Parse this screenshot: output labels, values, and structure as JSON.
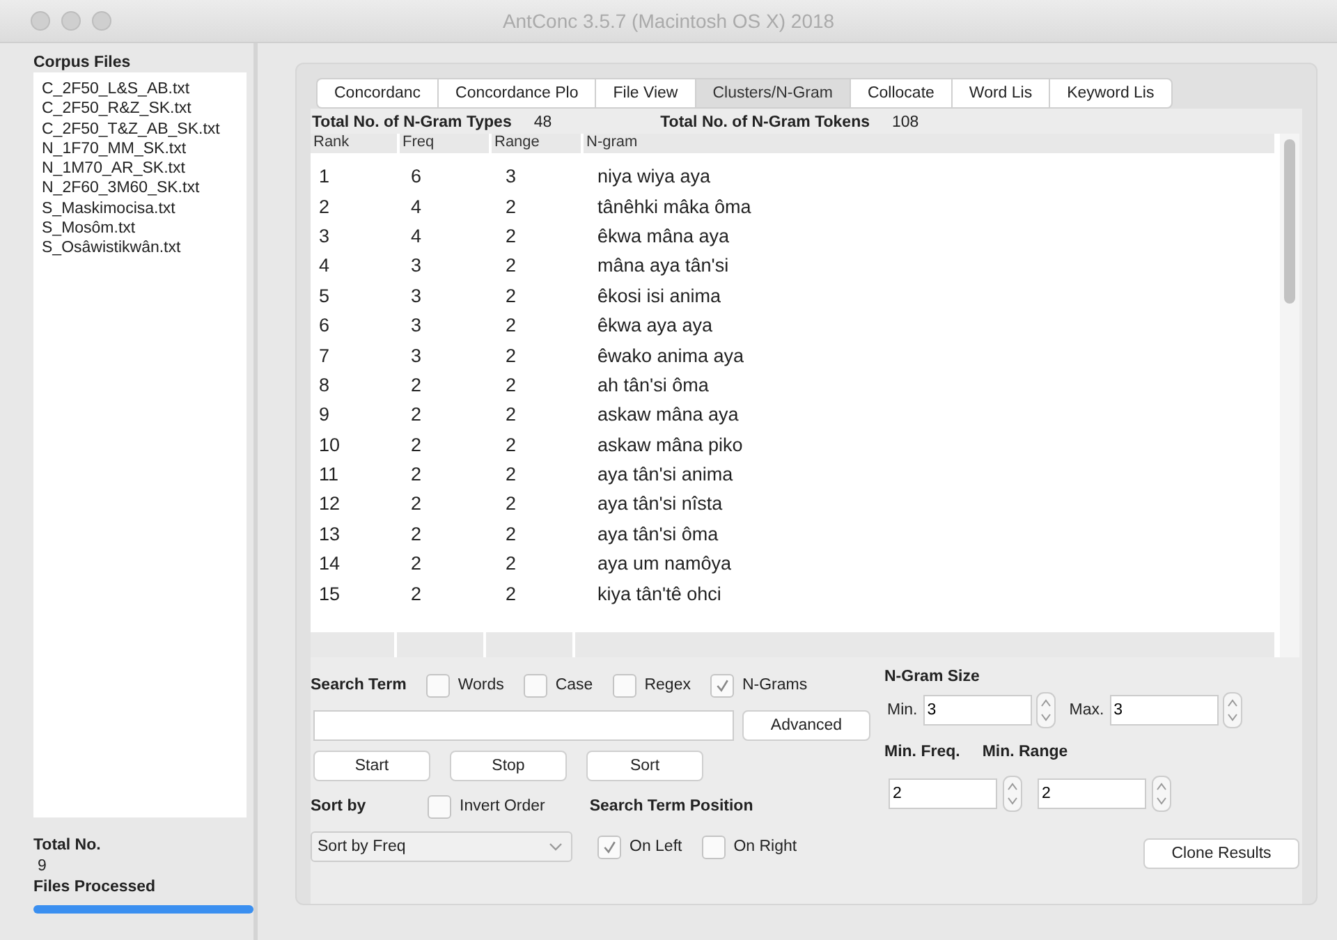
{
  "window": {
    "title": "AntConc 3.5.7 (Macintosh OS X) 2018"
  },
  "corpus_files": {
    "heading": "Corpus Files",
    "files": [
      "C_2F50_L&S_AB.txt",
      "C_2F50_R&Z_SK.txt",
      "C_2F50_T&Z_AB_SK.txt",
      "N_1F70_MM_SK.txt",
      "N_1M70_AR_SK.txt",
      "N_2F60_3M60_SK.txt",
      "S_Maskimocisa.txt",
      "S_Mosôm.txt",
      "S_Osâwistikwân.txt"
    ]
  },
  "total": {
    "label": "Total No.",
    "value": "9",
    "processed_label": "Files Processed",
    "level": 1
  },
  "tabs": [
    {
      "label": "Concordanc",
      "selected": false
    },
    {
      "label": "Concordance Plo",
      "selected": false
    },
    {
      "label": "File View",
      "selected": false
    },
    {
      "label": "Clusters/N-Gram",
      "selected": true
    },
    {
      "label": "Collocate",
      "selected": false
    },
    {
      "label": "Word Lis",
      "selected": false
    },
    {
      "label": "Keyword Lis",
      "selected": false
    }
  ],
  "summary": {
    "types_label": "Total No. of N-Gram Types",
    "types": "48",
    "tokens_label": "Total No. of N-Gram Tokens",
    "tokens": "108"
  },
  "table": {
    "columns": [
      "Rank",
      "Freq",
      "Range",
      "N-gram"
    ],
    "rows": [
      [
        "1",
        "6",
        "3",
        "niya wiya aya"
      ],
      [
        "2",
        "4",
        "2",
        "tânêhki mâka ôma"
      ],
      [
        "3",
        "4",
        "2",
        "êkwa mâna aya"
      ],
      [
        "4",
        "3",
        "2",
        "mâna aya tân'si"
      ],
      [
        "5",
        "3",
        "2",
        "êkosi isi anima"
      ],
      [
        "6",
        "3",
        "2",
        "êkwa aya aya"
      ],
      [
        "7",
        "3",
        "2",
        "êwako anima aya"
      ],
      [
        "8",
        "2",
        "2",
        "ah tân'si ôma"
      ],
      [
        "9",
        "2",
        "2",
        "askaw mâna aya"
      ],
      [
        "10",
        "2",
        "2",
        "askaw mâna piko"
      ],
      [
        "11",
        "2",
        "2",
        "aya tân'si anima"
      ],
      [
        "12",
        "2",
        "2",
        "aya tân'si nîsta"
      ],
      [
        "13",
        "2",
        "2",
        "aya tân'si ôma"
      ],
      [
        "14",
        "2",
        "2",
        "aya um namôya"
      ],
      [
        "15",
        "2",
        "2",
        "kiya tân'tê ohci"
      ]
    ]
  },
  "search": {
    "label": "Search Term",
    "options": [
      {
        "label": "Words",
        "checked": false
      },
      {
        "label": "Case",
        "checked": false
      },
      {
        "label": "Regex",
        "checked": false
      },
      {
        "label": "N-Grams",
        "checked": true
      }
    ],
    "advanced": "Advanced"
  },
  "buttons": [
    "Start",
    "Stop",
    "Sort"
  ],
  "sort": {
    "label": "Sort by",
    "invert": {
      "label": "Invert Order",
      "checked": false
    },
    "value": "Sort by Freq"
  },
  "position": {
    "label": "Search Term Position",
    "options": [
      {
        "label": "On Left",
        "checked": true
      },
      {
        "label": "On Right",
        "checked": false
      }
    ]
  },
  "ngram_size": {
    "label": "N-Gram Size",
    "min_label": "Min.",
    "min": "3",
    "max_label": "Max.",
    "max": "3"
  },
  "min_freq": {
    "label": "Min. Freq.",
    "value": "2"
  },
  "min_range": {
    "label": "Min. Range",
    "value": "2"
  },
  "clone": "Clone Results"
}
